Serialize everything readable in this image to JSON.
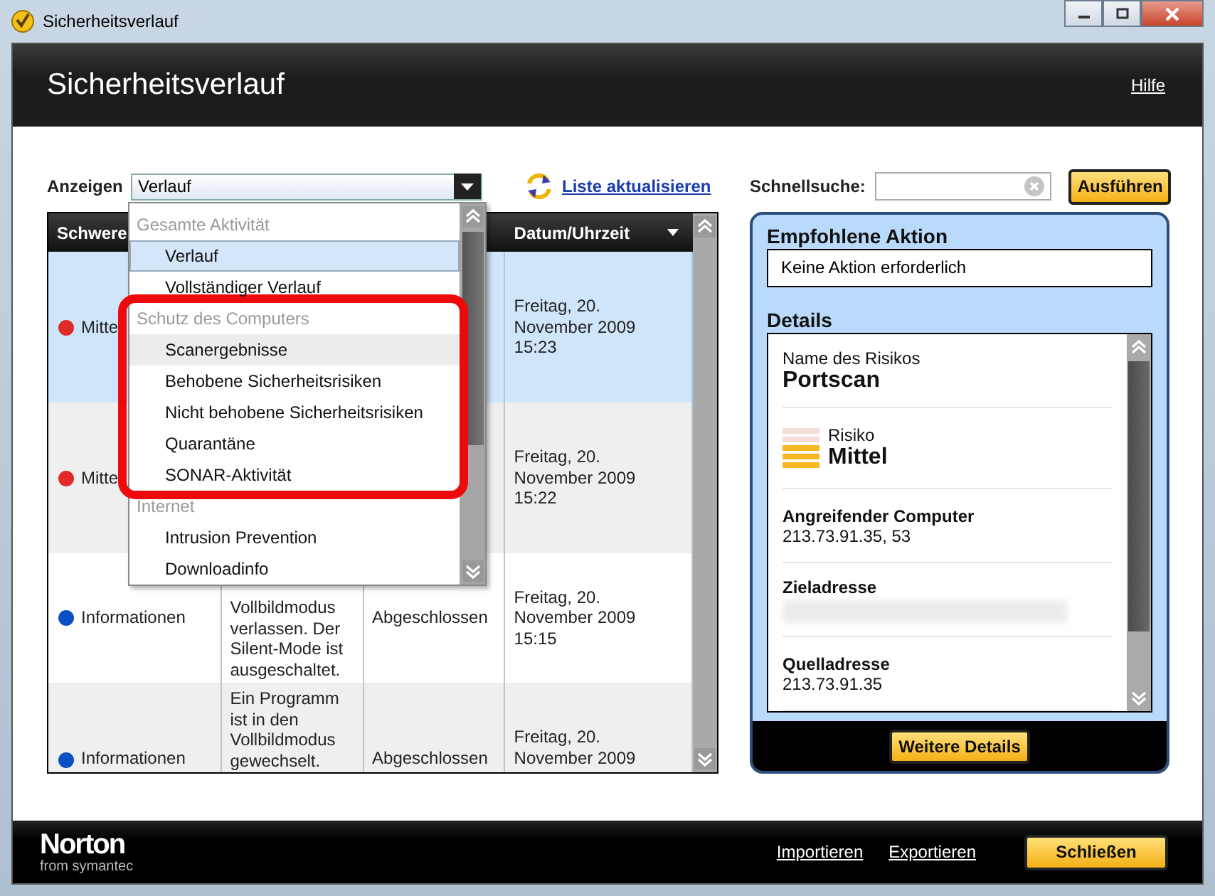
{
  "window": {
    "title": "Sicherheitsverlauf"
  },
  "header": {
    "title": "Sicherheitsverlauf",
    "help_link": "Hilfe"
  },
  "filter": {
    "label": "Anzeigen",
    "value": "Verlauf",
    "open": true,
    "groups": [
      {
        "header": "Gesamte Aktivität",
        "highlighted": false,
        "items": [
          {
            "label": "Verlauf",
            "selected": true,
            "hovered": false
          },
          {
            "label": "Vollständiger Verlauf",
            "selected": false,
            "hovered": false
          }
        ]
      },
      {
        "header": "Schutz des Computers",
        "highlighted": true,
        "items": [
          {
            "label": "Scanergebnisse",
            "selected": false,
            "hovered": true
          },
          {
            "label": "Behobene Sicherheitsrisiken",
            "selected": false,
            "hovered": false
          },
          {
            "label": "Nicht behobene Sicherheitsrisiken",
            "selected": false,
            "hovered": false
          },
          {
            "label": "Quarantäne",
            "selected": false,
            "hovered": false
          },
          {
            "label": "SONAR-Aktivität",
            "selected": false,
            "hovered": false
          }
        ]
      },
      {
        "header": "Internet",
        "highlighted": false,
        "items": [
          {
            "label": "Intrusion Prevention",
            "selected": false,
            "hovered": false
          },
          {
            "label": "Downloadinfo",
            "selected": false,
            "hovered": false
          }
        ]
      }
    ]
  },
  "refresh_link": "Liste aktualisieren",
  "quick_search": {
    "label": "Schnellsuche:",
    "button": "Ausführen"
  },
  "table": {
    "columns": [
      "Schwere",
      null,
      null,
      "Datum/Uhrzeit"
    ],
    "rows": [
      {
        "severity": "Mitte",
        "color": "#e02a2a",
        "datetime": "Freitag, 20. November 2009 15:23",
        "selected": true
      },
      {
        "severity": "Mitte",
        "color": "#e02a2a",
        "datetime": "Freitag, 20. November 2009 15:22",
        "selected": false
      },
      {
        "severity": "Informationen",
        "color": "#0b4fc4",
        "description": "Vollbildmodus verlassen. Der Silent-Mode ist ausgeschaltet.",
        "status": "Abgeschlossen",
        "datetime": "Freitag, 20. November 2009 15:15",
        "selected": false
      },
      {
        "severity": "Informationen",
        "color": "#0b4fc4",
        "description": "Ein Programm ist in den Vollbildmodus gewechselt.",
        "status": "Abgeschlossen",
        "datetime": "Freitag, 20. November 2009",
        "selected": false
      }
    ]
  },
  "panel": {
    "recommended_title": "Empfohlene Aktion",
    "recommended_text": "Keine Aktion erforderlich",
    "details_title": "Details",
    "details": [
      {
        "kind": "name",
        "label": "Name des Risikos",
        "value": "Portscan"
      },
      {
        "kind": "risk",
        "label": "Risiko",
        "value": "Mittel"
      },
      {
        "kind": "field",
        "label": "Angreifender Computer",
        "value": "213.73.91.35, 53"
      },
      {
        "kind": "redacted",
        "label": "Zieladresse"
      },
      {
        "kind": "field",
        "label": "Quelladresse",
        "value": "213.73.91.35"
      }
    ],
    "button": "Weitere Details"
  },
  "footer": {
    "logo": "Norton",
    "logo_sub": "from symantec",
    "links": [
      "Importieren",
      "Exportieren"
    ],
    "button": "Schließen"
  }
}
